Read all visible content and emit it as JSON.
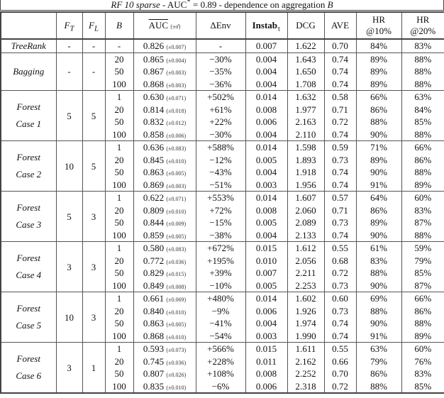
{
  "title": {
    "prefix_italic": "RF 10 sparse",
    "middle": " - AUC",
    "sup": "*",
    "rest": " = 0.89 - dependence on aggregation ",
    "var": "B"
  },
  "headers": {
    "ft": "F",
    "ft_sub": "T",
    "fl": "F",
    "fl_sub": "L",
    "b": "B",
    "auc": "AUC",
    "auc_sd": "(±σ̂)",
    "denv": "ΔEnv",
    "instab": "Instab",
    "instab_sub": "τ",
    "dcg": "DCG",
    "ave": "AVE",
    "hr10_a": "HR",
    "hr10_b": "@10%",
    "hr20_a": "HR",
    "hr20_b": "@20%"
  },
  "groups": [
    {
      "label": "TreeRank",
      "label2": "",
      "italic": true,
      "ft": "-",
      "fl": "-",
      "rows": [
        {
          "b": "-",
          "auc": "0.826",
          "sd": "(±0.007)",
          "denv": "-",
          "instab": "0.007",
          "dcg": "1.622",
          "ave": "0.70",
          "hr10": "84%",
          "hr20": "83%"
        }
      ]
    },
    {
      "label": "Bagging",
      "label2": "",
      "italic": true,
      "ft": "-",
      "fl": "-",
      "rows": [
        {
          "b": "20",
          "auc": "0.865",
          "sd": "(±0.004)",
          "denv": "−30%",
          "instab": "0.004",
          "dcg": "1.643",
          "ave": "0.74",
          "hr10": "89%",
          "hr20": "88%"
        },
        {
          "b": "50",
          "auc": "0.867",
          "sd": "(±0.003)",
          "denv": "−35%",
          "instab": "0.004",
          "dcg": "1.650",
          "ave": "0.74",
          "hr10": "89%",
          "hr20": "88%"
        },
        {
          "b": "100",
          "auc": "0.868",
          "sd": "(±0.003)",
          "denv": "−36%",
          "instab": "0.004",
          "dcg": "1.708",
          "ave": "0.74",
          "hr10": "89%",
          "hr20": "88%"
        }
      ]
    },
    {
      "label": "Forest",
      "label2": "Case 1",
      "italic": true,
      "ft": "5",
      "fl": "5",
      "rows": [
        {
          "b": "1",
          "auc": "0.630",
          "sd": "(±0.071)",
          "denv": "+502%",
          "instab": "0.014",
          "dcg": "1.632",
          "ave": "0.58",
          "hr10": "66%",
          "hr20": "63%"
        },
        {
          "b": "20",
          "auc": "0.814",
          "sd": "(±0.018)",
          "denv": "+61%",
          "instab": "0.008",
          "dcg": "1.977",
          "ave": "0.71",
          "hr10": "86%",
          "hr20": "84%"
        },
        {
          "b": "50",
          "auc": "0.832",
          "sd": "(±0.012)",
          "denv": "+22%",
          "instab": "0.006",
          "dcg": "2.163",
          "ave": "0.72",
          "hr10": "88%",
          "hr20": "85%"
        },
        {
          "b": "100",
          "auc": "0.858",
          "sd": "(±0.006)",
          "denv": "−30%",
          "instab": "0.004",
          "dcg": "2.110",
          "ave": "0.74",
          "hr10": "90%",
          "hr20": "88%"
        }
      ]
    },
    {
      "label": "Forest",
      "label2": "Case 2",
      "italic": true,
      "ft": "10",
      "fl": "5",
      "rows": [
        {
          "b": "1",
          "auc": "0.636",
          "sd": "(±0.083)",
          "denv": "+588%",
          "instab": "0.014",
          "dcg": "1.598",
          "ave": "0.59",
          "hr10": "71%",
          "hr20": "66%"
        },
        {
          "b": "20",
          "auc": "0.845",
          "sd": "(±0.010)",
          "denv": "−12%",
          "instab": "0.005",
          "dcg": "1.893",
          "ave": "0.73",
          "hr10": "89%",
          "hr20": "86%"
        },
        {
          "b": "50",
          "auc": "0.863",
          "sd": "(±0.005)",
          "denv": "−43%",
          "instab": "0.004",
          "dcg": "1.918",
          "ave": "0.74",
          "hr10": "90%",
          "hr20": "88%"
        },
        {
          "b": "100",
          "auc": "0.869",
          "sd": "(±0.003)",
          "denv": "−51%",
          "instab": "0.003",
          "dcg": "1.956",
          "ave": "0.74",
          "hr10": "91%",
          "hr20": "89%"
        }
      ]
    },
    {
      "label": "Forest",
      "label2": "Case 3",
      "italic": true,
      "ft": "5",
      "fl": "3",
      "rows": [
        {
          "b": "1",
          "auc": "0.622",
          "sd": "(±0.071)",
          "denv": "+553%",
          "instab": "0.014",
          "dcg": "1.607",
          "ave": "0.57",
          "hr10": "64%",
          "hr20": "60%"
        },
        {
          "b": "20",
          "auc": "0.809",
          "sd": "(±0.010)",
          "denv": "+72%",
          "instab": "0.008",
          "dcg": "2.060",
          "ave": "0.71",
          "hr10": "86%",
          "hr20": "83%"
        },
        {
          "b": "50",
          "auc": "0.844",
          "sd": "(±0.009)",
          "denv": "−15%",
          "instab": "0.005",
          "dcg": "2.089",
          "ave": "0.73",
          "hr10": "89%",
          "hr20": "87%"
        },
        {
          "b": "100",
          "auc": "0.859",
          "sd": "(±0.005)",
          "denv": "−38%",
          "instab": "0.004",
          "dcg": "2.133",
          "ave": "0.74",
          "hr10": "90%",
          "hr20": "88%"
        }
      ]
    },
    {
      "label": "Forest",
      "label2": "Case 4",
      "italic": true,
      "ft": "3",
      "fl": "3",
      "rows": [
        {
          "b": "1",
          "auc": "0.580",
          "sd": "(±0.083)",
          "denv": "+672%",
          "instab": "0.015",
          "dcg": "1.612",
          "ave": "0.55",
          "hr10": "61%",
          "hr20": "59%"
        },
        {
          "b": "20",
          "auc": "0.772",
          "sd": "(±0.036)",
          "denv": "+195%",
          "instab": "0.010",
          "dcg": "2.056",
          "ave": "0.68",
          "hr10": "83%",
          "hr20": "79%"
        },
        {
          "b": "50",
          "auc": "0.829",
          "sd": "(±0.015)",
          "denv": "+39%",
          "instab": "0.007",
          "dcg": "2.211",
          "ave": "0.72",
          "hr10": "88%",
          "hr20": "85%"
        },
        {
          "b": "100",
          "auc": "0.849",
          "sd": "(±0.008)",
          "denv": "−10%",
          "instab": "0.005",
          "dcg": "2.253",
          "ave": "0.73",
          "hr10": "90%",
          "hr20": "87%"
        }
      ]
    },
    {
      "label": "Forest",
      "label2": "Case 5",
      "italic": true,
      "ft": "10",
      "fl": "3",
      "rows": [
        {
          "b": "1",
          "auc": "0.661",
          "sd": "(±0.069)",
          "denv": "+480%",
          "instab": "0.014",
          "dcg": "1.602",
          "ave": "0.60",
          "hr10": "69%",
          "hr20": "66%"
        },
        {
          "b": "20",
          "auc": "0.840",
          "sd": "(±0.010)",
          "denv": "−9%",
          "instab": "0.006",
          "dcg": "1.926",
          "ave": "0.73",
          "hr10": "88%",
          "hr20": "86%"
        },
        {
          "b": "50",
          "auc": "0.863",
          "sd": "(±0.005)",
          "denv": "−41%",
          "instab": "0.004",
          "dcg": "1.974",
          "ave": "0.74",
          "hr10": "90%",
          "hr20": "88%"
        },
        {
          "b": "100",
          "auc": "0.868",
          "sd": "(±0.010)",
          "denv": "−54%",
          "instab": "0.003",
          "dcg": "1.990",
          "ave": "0.74",
          "hr10": "91%",
          "hr20": "89%"
        }
      ]
    },
    {
      "label": "Forest",
      "label2": "Case 6",
      "italic": true,
      "ft": "3",
      "fl": "1",
      "rows": [
        {
          "b": "1",
          "auc": "0.593",
          "sd": "(±0.073)",
          "denv": "+566%",
          "instab": "0.015",
          "dcg": "1.611",
          "ave": "0.55",
          "hr10": "63%",
          "hr20": "60%"
        },
        {
          "b": "20",
          "auc": "0.745",
          "sd": "(±0.036)",
          "denv": "+228%",
          "instab": "0.011",
          "dcg": "2.162",
          "ave": "0.66",
          "hr10": "79%",
          "hr20": "76%"
        },
        {
          "b": "50",
          "auc": "0.807",
          "sd": "(±0.026)",
          "denv": "+108%",
          "instab": "0.008",
          "dcg": "2.252",
          "ave": "0.70",
          "hr10": "86%",
          "hr20": "83%"
        },
        {
          "b": "100",
          "auc": "0.835",
          "sd": "(±0.010)",
          "denv": "−6%",
          "instab": "0.006",
          "dcg": "2.318",
          "ave": "0.72",
          "hr10": "88%",
          "hr20": "85%"
        }
      ]
    }
  ]
}
